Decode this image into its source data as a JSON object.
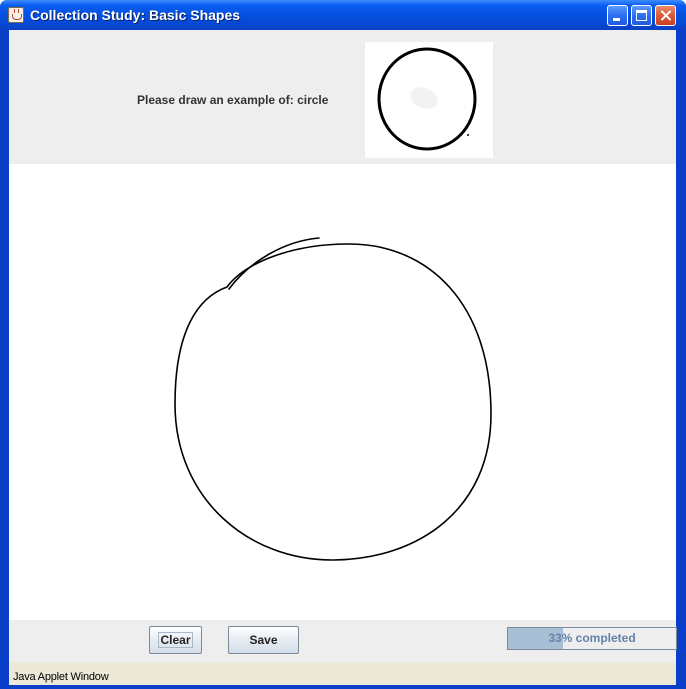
{
  "window": {
    "title": "Collection Study: Basic Shapes",
    "title_icon": "java-cup-icon",
    "controls": [
      "minimize",
      "maximize",
      "close"
    ]
  },
  "prompt": {
    "text": "Please draw an example of: circle"
  },
  "example": {
    "shape": "circle"
  },
  "canvas": {
    "stroke_color": "#000000"
  },
  "buttons": {
    "clear_label": "Clear",
    "save_label": "Save"
  },
  "progress": {
    "percent": 33,
    "text": "33% completed"
  },
  "status": {
    "text": "Java Applet Window"
  },
  "colors": {
    "titlebar": "#0a5df0",
    "progress_fill": "#a9bfd6",
    "progress_text": "#6383a8",
    "panel": "#eeeeee",
    "status_bar": "#ece9d8"
  }
}
